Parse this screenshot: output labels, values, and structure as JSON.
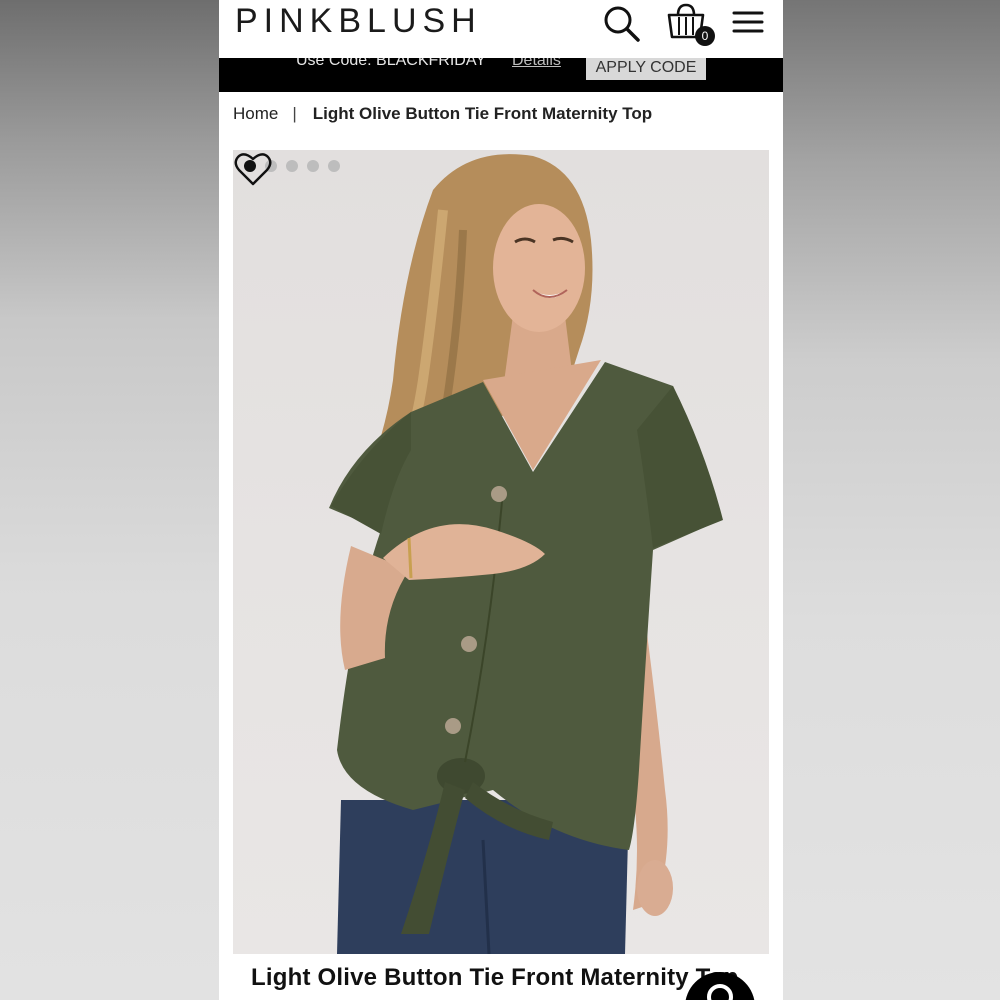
{
  "brand": {
    "logo_text": "PINKBLUSH"
  },
  "header": {
    "cart_count": "0",
    "icons": [
      "search-icon",
      "shopping-bag-icon",
      "hamburger-menu-icon"
    ]
  },
  "promo": {
    "code_text": "Use Code: BLACKFRIDAY",
    "details_link": "Details",
    "apply_button": "APPLY CODE"
  },
  "breadcrumb": {
    "home": "Home",
    "separator": "|",
    "current": "Light Olive Button Tie Front Maternity Top"
  },
  "gallery": {
    "image_count": 5,
    "active_index": 0,
    "favorite_icon": "heart-outline-icon"
  },
  "product": {
    "title": "Light Olive Button Tie Front Maternity Top"
  },
  "colors": {
    "promo_bg": "#000000",
    "top_olive": "#4e5a3d",
    "accent": "#111111"
  }
}
